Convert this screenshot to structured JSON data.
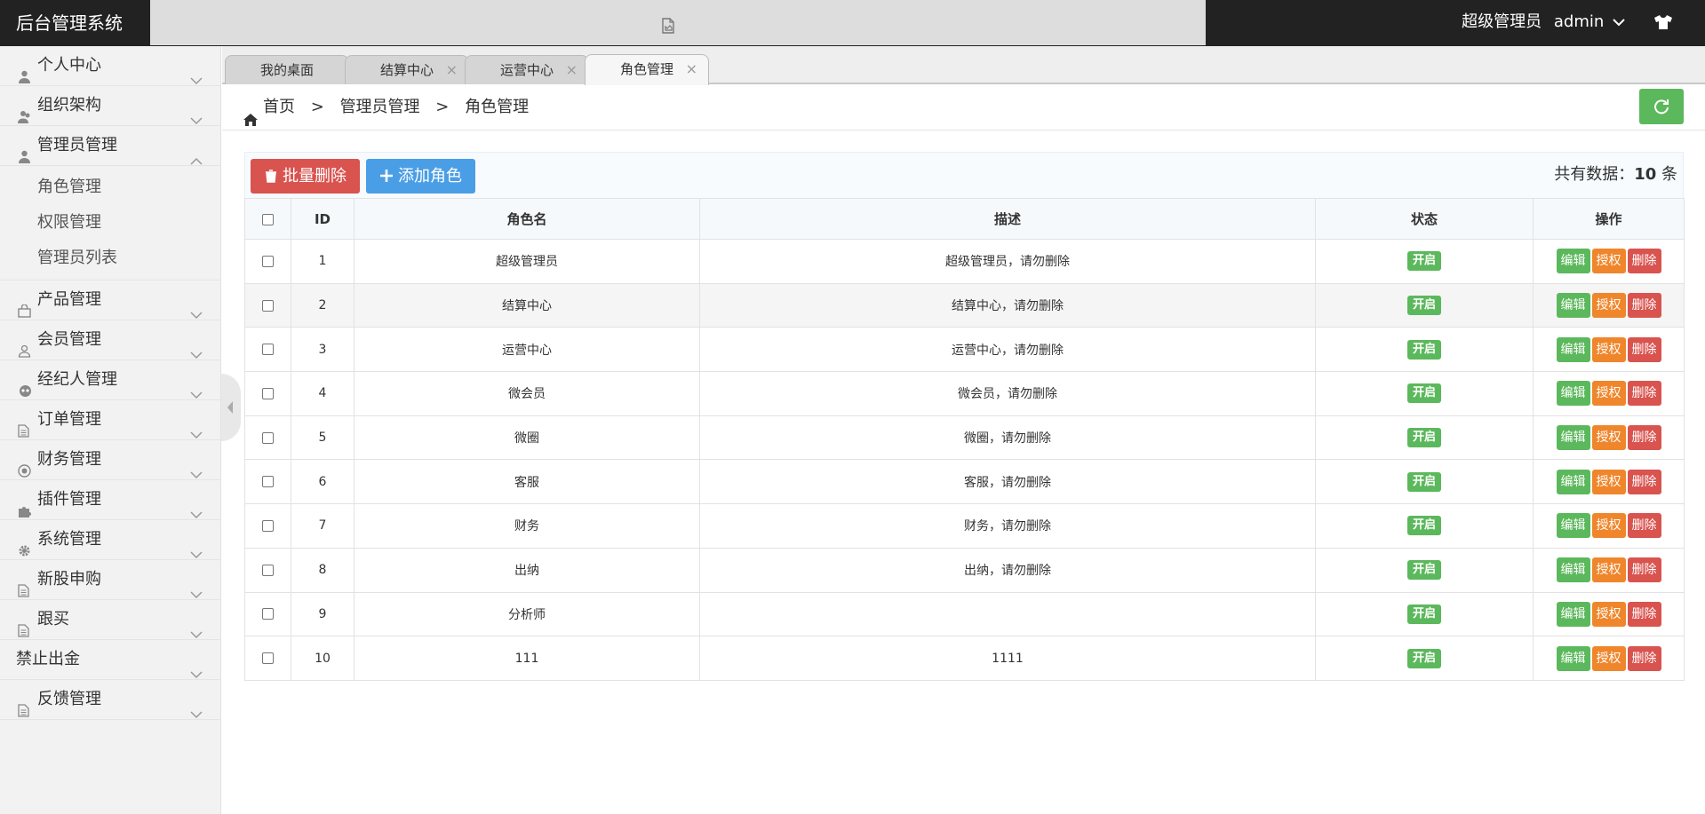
{
  "app": {
    "title": "后台管理系统"
  },
  "header": {
    "role": "超级管理员",
    "username": "admin"
  },
  "sidebar": {
    "items": [
      {
        "label": "个人中心",
        "icon": "user-icon"
      },
      {
        "label": "组织架构",
        "icon": "users-icon"
      },
      {
        "label": "管理员管理",
        "icon": "user-icon",
        "expanded": true,
        "children": [
          "角色管理",
          "权限管理",
          "管理员列表"
        ]
      },
      {
        "label": "产品管理",
        "icon": "bag-icon"
      },
      {
        "label": "会员管理",
        "icon": "user-outline-icon"
      },
      {
        "label": "经纪人管理",
        "icon": "group-icon"
      },
      {
        "label": "订单管理",
        "icon": "doc-icon"
      },
      {
        "label": "财务管理",
        "icon": "coin-icon"
      },
      {
        "label": "插件管理",
        "icon": "puzzle-icon"
      },
      {
        "label": "系统管理",
        "icon": "gear-icon"
      },
      {
        "label": "新股申购",
        "icon": "doc-icon"
      },
      {
        "label": "跟买",
        "icon": "doc-icon"
      },
      {
        "label": "禁止出金",
        "icon": ""
      },
      {
        "label": "反馈管理",
        "icon": "doc-icon"
      }
    ]
  },
  "tabs": [
    {
      "label": "我的桌面",
      "closable": false
    },
    {
      "label": "结算中心",
      "closable": true
    },
    {
      "label": "运营中心",
      "closable": true
    },
    {
      "label": "角色管理",
      "closable": true,
      "active": true
    }
  ],
  "breadcrumb": [
    "首页",
    "管理员管理",
    "角色管理"
  ],
  "breadcrumb_sep": ">",
  "toolbar": {
    "batch_delete": "批量删除",
    "add_role": "添加角色",
    "total_prefix": "共有数据：",
    "total_count": "10",
    "total_suffix": "条"
  },
  "table": {
    "headers": [
      "ID",
      "角色名",
      "描述",
      "状态",
      "操作"
    ],
    "actions": {
      "edit": "编辑",
      "auth": "授权",
      "delete": "删除"
    },
    "rows": [
      {
        "id": "1",
        "name": "超级管理员",
        "desc": "超级管理员，请勿删除",
        "status": "开启"
      },
      {
        "id": "2",
        "name": "结算中心",
        "desc": "结算中心，请勿删除",
        "status": "开启"
      },
      {
        "id": "3",
        "name": "运营中心",
        "desc": "运营中心，请勿删除",
        "status": "开启"
      },
      {
        "id": "4",
        "name": "微会员",
        "desc": "微会员，请勿删除",
        "status": "开启"
      },
      {
        "id": "5",
        "name": "微圈",
        "desc": "微圈，请勿删除",
        "status": "开启"
      },
      {
        "id": "6",
        "name": "客服",
        "desc": "客服，请勿删除",
        "status": "开启"
      },
      {
        "id": "7",
        "name": "财务",
        "desc": "财务，请勿删除",
        "status": "开启"
      },
      {
        "id": "8",
        "name": "出纳",
        "desc": "出纳，请勿删除",
        "status": "开启"
      },
      {
        "id": "9",
        "name": "分析师",
        "desc": "",
        "status": "开启"
      },
      {
        "id": "10",
        "name": "111",
        "desc": "1111",
        "status": "开启"
      }
    ]
  },
  "colors": {
    "green": "#5cb85c",
    "orange": "#f0862b",
    "red": "#d9534f",
    "blue": "#4a9ee6",
    "header": "#222222"
  }
}
